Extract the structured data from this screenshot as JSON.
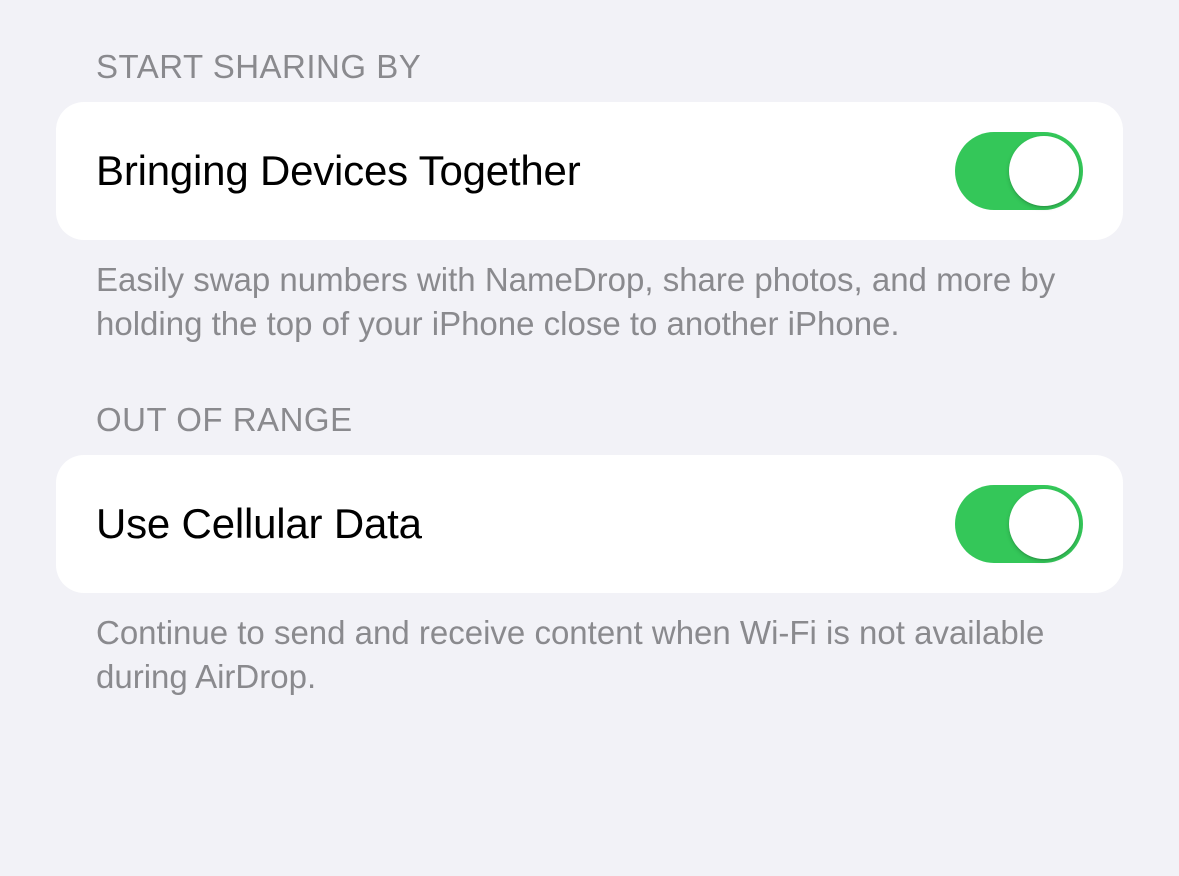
{
  "sections": {
    "sharing": {
      "header": "Start Sharing By",
      "row_label": "Bringing Devices Together",
      "toggle_on": true,
      "footer": "Easily swap numbers with NameDrop, share photos, and more by holding the top of your iPhone close to another iPhone."
    },
    "out_of_range": {
      "header": "Out of Range",
      "row_label": "Use Cellular Data",
      "toggle_on": true,
      "footer": "Continue to send and receive content when Wi-Fi is not available during AirDrop."
    }
  }
}
